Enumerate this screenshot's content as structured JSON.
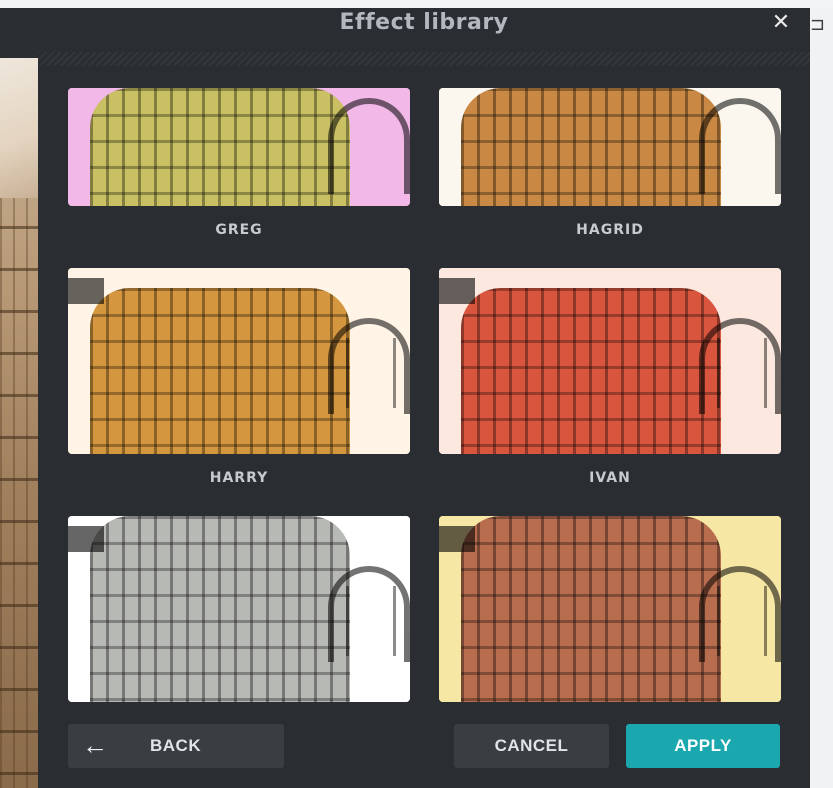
{
  "dialog": {
    "title": "Effect library",
    "close_glyph": "✕"
  },
  "effects": [
    {
      "label": "GREG",
      "tint": "#c9c063",
      "sky": "#f2b8e8"
    },
    {
      "label": "HAGRID",
      "tint": "#c98843",
      "sky": "#fbf7ee"
    },
    {
      "label": "HARRY",
      "tint": "#d4963e",
      "sky": "#fff4e6"
    },
    {
      "label": "IVAN",
      "tint": "#d9553e",
      "sky": "#fde8df"
    },
    {
      "label": "",
      "tint": "#b7b9b4",
      "sky": "#ffffff"
    },
    {
      "label": "",
      "tint": "#b96d4f",
      "sky": "#f7e7a5"
    }
  ],
  "buttons": {
    "back_label": "BACK",
    "back_icon": "arrow-left-icon",
    "cancel_label": "CANCEL",
    "apply_label": "APPLY"
  },
  "background": {
    "corner_icon": "window-restore-icon",
    "corner_glyph": "⊐"
  },
  "colors": {
    "modal_bg": "#2a2d31",
    "button_bg": "#3a3e43",
    "accent": "#1aa7ad",
    "title": "#b3b8be",
    "label": "#c6cbd0"
  }
}
